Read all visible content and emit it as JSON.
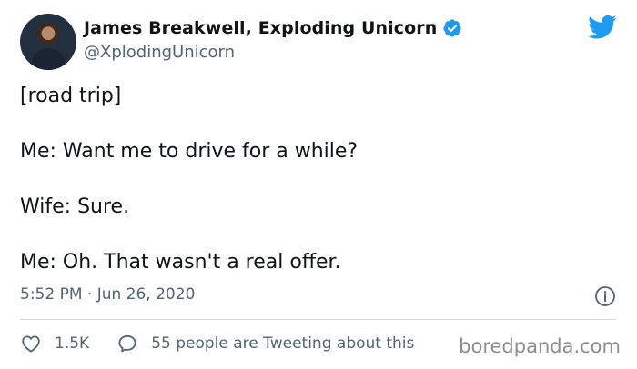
{
  "author": {
    "display_name": "James Breakwell, Exploding Unicorn",
    "handle": "@XplodingUnicorn",
    "verified": true
  },
  "tweet": {
    "lines": [
      "[road trip]",
      "Me: Want me to drive for a while?",
      "Wife: Sure.",
      "Me: Oh. That wasn't a real offer."
    ],
    "timestamp": "5:52 PM · Jun 26, 2020"
  },
  "actions": {
    "likes": "1.5K",
    "conversation": "55 people are Tweeting about this"
  },
  "watermark": "boredpanda.com",
  "icons": {
    "logo": "twitter-bird-icon",
    "verified": "verified-badge-icon",
    "info": "info-icon",
    "like": "heart-icon",
    "reply": "speech-bubble-icon"
  },
  "colors": {
    "text": "#0f1419",
    "secondary": "#536471",
    "brand": "#1d9bf0",
    "divider": "#cfd9de"
  }
}
